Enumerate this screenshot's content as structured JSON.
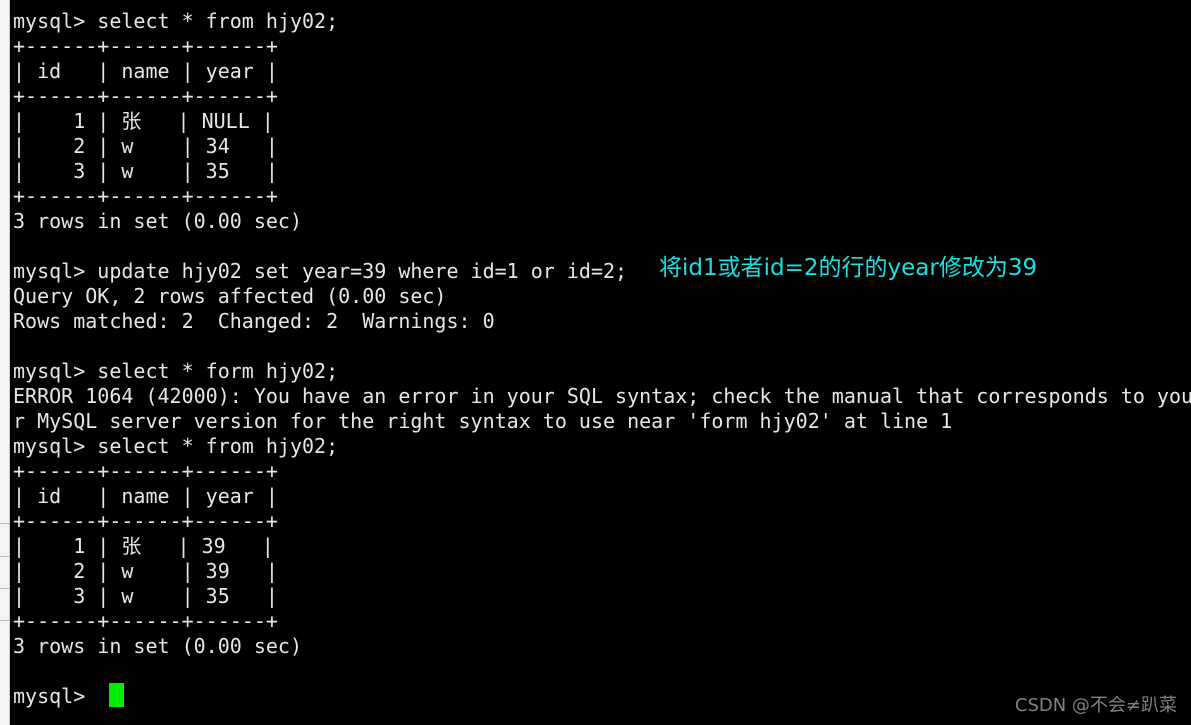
{
  "terminal": {
    "prompt": "mysql> ",
    "colors": {
      "background": "#000000",
      "foreground": "#e6e6e6",
      "annotation": "#17e0e0",
      "cursor": "#00ed00",
      "watermark": "#8c8c8c"
    },
    "lines": [
      "mysql> select * from hjy02;",
      "+------+------+------+",
      "| id   | name | year |",
      "+------+------+------+",
      "|    1 | 张   | NULL |",
      "|    2 | w    | 34   |",
      "|    3 | w    | 35   |",
      "+------+------+------+",
      "3 rows in set (0.00 sec)",
      "",
      "mysql> update hjy02 set year=39 where id=1 or id=2;",
      "Query OK, 2 rows affected (0.00 sec)",
      "Rows matched: 2  Changed: 2  Warnings: 0",
      "",
      "mysql> select * form hjy02;",
      "ERROR 1064 (42000): You have an error in your SQL syntax; check the manual that corresponds to you",
      "r MySQL server version for the right syntax to use near 'form hjy02' at line 1",
      "mysql> select * from hjy02;",
      "+------+------+------+",
      "| id   | name | year |",
      "+------+------+------+",
      "|    1 | 张   | 39   |",
      "|    2 | w    | 39   |",
      "|    3 | w    | 35   |",
      "+------+------+------+",
      "3 rows in set (0.00 sec)",
      "",
      "mysql> "
    ]
  },
  "annotation": {
    "text": "将id1或者id=2的行的year修改为39"
  },
  "watermark": {
    "text": "CSDN @不会≠趴菜"
  },
  "query_results": {
    "first_select": {
      "statement": "select * from hjy02;",
      "columns": [
        "id",
        "name",
        "year"
      ],
      "rows": [
        [
          "1",
          "张",
          "NULL"
        ],
        [
          "2",
          "w",
          "34"
        ],
        [
          "3",
          "w",
          "35"
        ]
      ],
      "status": "3 rows in set (0.00 sec)"
    },
    "update": {
      "statement": "update hjy02 set year=39 where id=1 or id=2;",
      "result": "Query OK, 2 rows affected (0.00 sec)",
      "detail": "Rows matched: 2  Changed: 2  Warnings: 0"
    },
    "error_select": {
      "statement": "select * form hjy02;",
      "error_code": "ERROR 1064 (42000)",
      "message": "You have an error in your SQL syntax; check the manual that corresponds to your MySQL server version for the right syntax to use near 'form hjy02' at line 1"
    },
    "second_select": {
      "statement": "select * from hjy02;",
      "columns": [
        "id",
        "name",
        "year"
      ],
      "rows": [
        [
          "1",
          "张",
          "39"
        ],
        [
          "2",
          "w",
          "39"
        ],
        [
          "3",
          "w",
          "35"
        ]
      ],
      "status": "3 rows in set (0.00 sec)"
    }
  }
}
